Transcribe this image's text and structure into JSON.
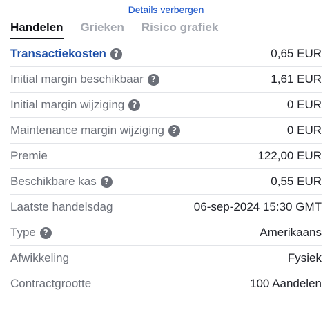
{
  "toggle": {
    "label": "Details verbergen"
  },
  "tabs": [
    {
      "label": "Handelen",
      "active": true
    },
    {
      "label": "Grieken",
      "active": false
    },
    {
      "label": "Risico grafiek",
      "active": false
    }
  ],
  "details": [
    {
      "label": "Transactiekosten",
      "value": "0,65 EUR",
      "help_icon": "question-circle-icon"
    },
    {
      "label": "Initial margin beschikbaar",
      "value": "1,61 EUR",
      "help_icon": "question-circle-icon"
    },
    {
      "label": "Initial margin wijziging",
      "value": "0 EUR",
      "help_icon": "question-circle-icon"
    },
    {
      "label": "Maintenance margin wijziging",
      "value": "0 EUR",
      "help_icon": "question-circle-icon"
    },
    {
      "label": "Premie",
      "value": "122,00 EUR"
    },
    {
      "label": "Beschikbare kas",
      "value": "0,55 EUR",
      "help_icon": "question-circle-icon"
    },
    {
      "label": "Laatste handelsdag",
      "value": "06-sep-2024 15:30 GMT"
    },
    {
      "label": "Type",
      "value": "Amerikaans",
      "help_icon": "question-circle-icon"
    },
    {
      "label": "Afwikkeling",
      "value": "Fysiek"
    },
    {
      "label": "Contractgrootte",
      "value": "100 Aandelen"
    }
  ],
  "colors": {
    "link": "#1450c8",
    "highlight_label": "#1d4fa8",
    "muted_label": "#6b6f78",
    "divider": "#e2e4e8"
  }
}
